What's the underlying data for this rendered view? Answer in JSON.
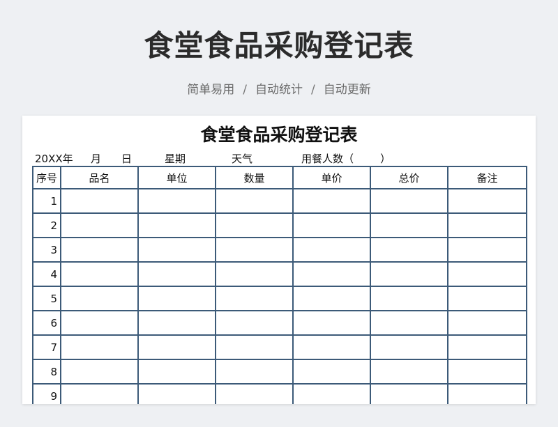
{
  "header": {
    "title": "食堂食品采购登记表",
    "tagline": [
      "简单易用",
      "自动统计",
      "自动更新"
    ],
    "separator": "/"
  },
  "sheet": {
    "title": "食堂食品采购登记表",
    "info": {
      "year": "20XX年",
      "month": "月",
      "day": "日",
      "weekday": "星期",
      "weather": "天气",
      "diners": "用餐人数（        ）"
    },
    "columns": [
      "序号",
      "品名",
      "单位",
      "数量",
      "单价",
      "总价",
      "备注"
    ],
    "rows": [
      {
        "no": "1"
      },
      {
        "no": "2"
      },
      {
        "no": "3"
      },
      {
        "no": "4"
      },
      {
        "no": "5"
      },
      {
        "no": "6"
      },
      {
        "no": "7"
      },
      {
        "no": "8"
      },
      {
        "no": "9"
      }
    ]
  },
  "colors": {
    "grid_border": "#3c5a78",
    "page_background": "#eef0f3",
    "sheet_background": "#ffffff"
  }
}
